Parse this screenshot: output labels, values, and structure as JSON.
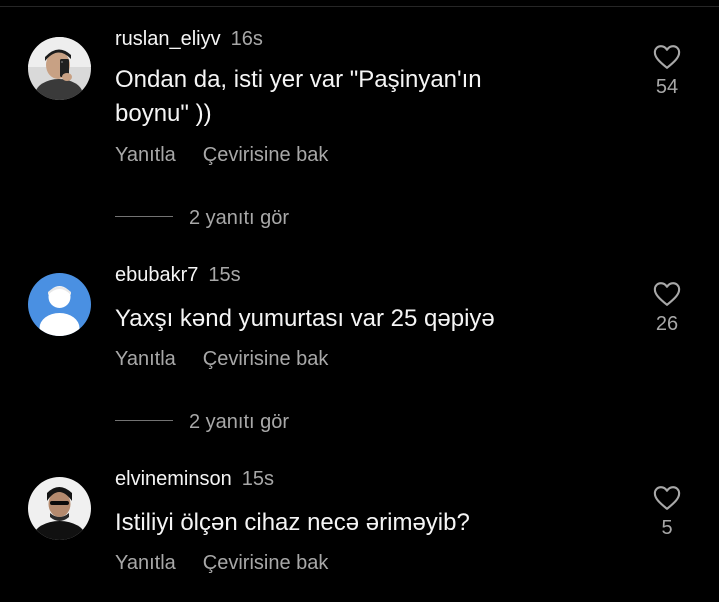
{
  "comments": [
    {
      "username": "ruslan_eliyv",
      "time": "16s",
      "text_line1": "Ondan da, isti yer var \"Paşinyan'ın",
      "text_line2": "boynu\" ))",
      "reply_label": "Yanıtla",
      "translate_label": "Çevirisine bak",
      "likes": "54",
      "view_replies": "2 yanıtı gör",
      "avatar": "user-photo"
    },
    {
      "username": "ebubakr7",
      "time": "15s",
      "text_line1": "Yaxşı kənd yumurtası var 25 qəpiyə",
      "reply_label": "Yanıtla",
      "translate_label": "Çevirisine bak",
      "likes": "26",
      "view_replies": "2 yanıtı gör",
      "avatar": "default-avatar"
    },
    {
      "username": "elvineminson",
      "time": "15s",
      "text_line1": "Istiliyi ölçən cihaz necə əriməyib?",
      "reply_label": "Yanıtla",
      "translate_label": "Çevirisine bak",
      "likes": "5",
      "avatar": "user-photo"
    }
  ],
  "colors": {
    "background": "#000000",
    "primary_text": "#f5f5f5",
    "secondary_text": "#a8a8a8",
    "default_avatar_bg": "#4a90e2"
  },
  "icons": {
    "like": "heart-outline-icon"
  }
}
